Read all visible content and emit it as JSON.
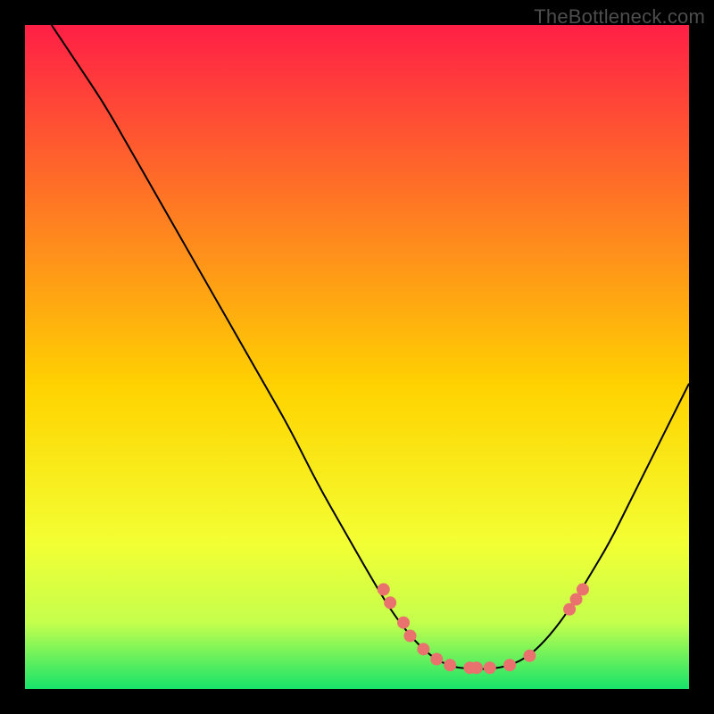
{
  "watermark": "TheBottleneck.com",
  "chart_data": {
    "type": "line",
    "title": "",
    "xlabel": "",
    "ylabel": "",
    "xlim": [
      0,
      100
    ],
    "ylim": [
      0,
      100
    ],
    "gradient_stops": [
      {
        "offset": 0,
        "color": "#ff1f46"
      },
      {
        "offset": 55,
        "color": "#ffd400"
      },
      {
        "offset": 78,
        "color": "#f3ff33"
      },
      {
        "offset": 90,
        "color": "#c4ff4d"
      },
      {
        "offset": 100,
        "color": "#17e36a"
      }
    ],
    "curve": [
      {
        "x": 4,
        "y": 100
      },
      {
        "x": 8,
        "y": 94
      },
      {
        "x": 12,
        "y": 88
      },
      {
        "x": 16,
        "y": 81
      },
      {
        "x": 20,
        "y": 74
      },
      {
        "x": 24,
        "y": 67
      },
      {
        "x": 28,
        "y": 60
      },
      {
        "x": 32,
        "y": 53
      },
      {
        "x": 36,
        "y": 46
      },
      {
        "x": 40,
        "y": 39
      },
      {
        "x": 44,
        "y": 31
      },
      {
        "x": 48,
        "y": 24
      },
      {
        "x": 52,
        "y": 17
      },
      {
        "x": 55,
        "y": 12
      },
      {
        "x": 58,
        "y": 8
      },
      {
        "x": 61,
        "y": 5
      },
      {
        "x": 64,
        "y": 3.4
      },
      {
        "x": 67,
        "y": 3
      },
      {
        "x": 70,
        "y": 3
      },
      {
        "x": 73,
        "y": 3.5
      },
      {
        "x": 76,
        "y": 5
      },
      {
        "x": 79,
        "y": 8
      },
      {
        "x": 82,
        "y": 12
      },
      {
        "x": 85,
        "y": 17
      },
      {
        "x": 88,
        "y": 22
      },
      {
        "x": 91,
        "y": 28
      },
      {
        "x": 94,
        "y": 34
      },
      {
        "x": 97,
        "y": 40
      },
      {
        "x": 100,
        "y": 46
      }
    ],
    "markers": [
      {
        "x": 54,
        "y": 15
      },
      {
        "x": 55,
        "y": 13
      },
      {
        "x": 57,
        "y": 10
      },
      {
        "x": 58,
        "y": 8
      },
      {
        "x": 60,
        "y": 6
      },
      {
        "x": 62,
        "y": 4.5
      },
      {
        "x": 64,
        "y": 3.6
      },
      {
        "x": 67,
        "y": 3.2
      },
      {
        "x": 68,
        "y": 3.2
      },
      {
        "x": 70,
        "y": 3.2
      },
      {
        "x": 73,
        "y": 3.6
      },
      {
        "x": 76,
        "y": 5
      },
      {
        "x": 82,
        "y": 12
      },
      {
        "x": 83,
        "y": 13.5
      },
      {
        "x": 84,
        "y": 15
      }
    ],
    "marker_color": "#e9726f",
    "curve_color": "#000000"
  }
}
